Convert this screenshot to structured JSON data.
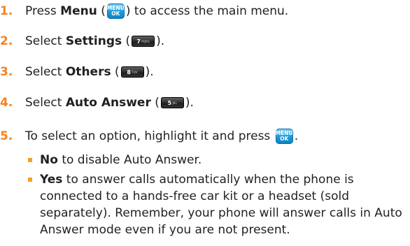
{
  "steps": [
    {
      "number": "1.",
      "pre": "Press ",
      "bold": "Menu",
      "post": " to access the main menu.",
      "key": {
        "type": "menu-key-icon",
        "top": "MENU",
        "bottom": "OK"
      }
    },
    {
      "number": "2.",
      "pre": "Select ",
      "bold": "Settings",
      "post": "",
      "key": {
        "type": "number-key-icon",
        "label": "7",
        "sub": "PQRS"
      }
    },
    {
      "number": "3.",
      "pre": "Select ",
      "bold": "Others",
      "post": "",
      "key": {
        "type": "number-key-icon",
        "label": "8",
        "sub": "TUV"
      }
    },
    {
      "number": "4.",
      "pre": "Select ",
      "bold": "Auto Answer",
      "post": "",
      "key": {
        "type": "number-key-icon",
        "label": "5",
        "sub": "JKL"
      }
    },
    {
      "number": "5.",
      "text": "To select an option, highlight it and press",
      "key": {
        "type": "menu-key-icon",
        "top": "MENU",
        "bottom": "OK"
      }
    }
  ],
  "options": [
    {
      "bold": "No",
      "text": " to disable Auto Answer."
    },
    {
      "bold": "Yes",
      "text": " to answer calls automatically when the phone is connected to a hands-free car kit or a headset (sold separately). Remember, your phone will answer calls in Auto Answer mode even if you are not present."
    }
  ],
  "colors": {
    "step_number": "#f58220",
    "bullet": "#f5a21f",
    "menu_key": "#1b9bd8",
    "number_key": "#1f1f1f"
  }
}
